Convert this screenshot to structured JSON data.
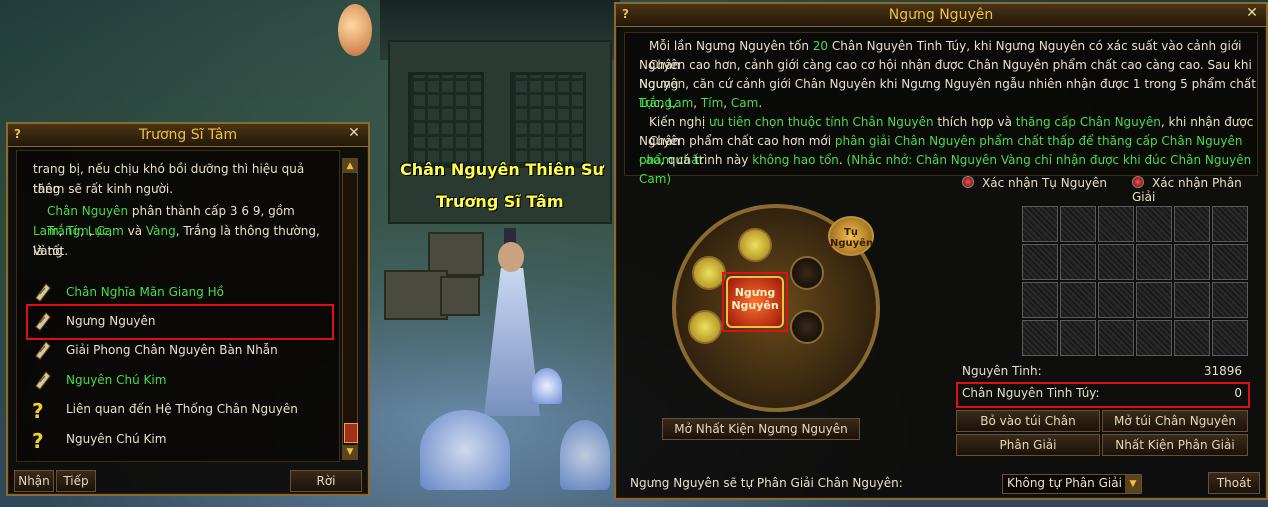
{
  "scene": {
    "npc_name_line1": "Chân Nguyên Thiên Sư",
    "npc_name_line2": "Trương Sĩ Tâm"
  },
  "left_panel": {
    "title": "Trương Sĩ Tâm",
    "help_icon": "?",
    "close_icon": "✕",
    "text_line1": "trang bị, nếu chịu khó bồi dưỡng thì hiệu quả tăng",
    "text_line2": "thêm sẽ rất kinh người.",
    "text_line3_prefix": "Chân Nguyên",
    "text_line3_mid": " phân thành cấp 3 6 9, gồm ",
    "w_trang": "Trắng",
    "w_luc": "Lục",
    "w_lam": "Lam",
    "w_tim": "Tím",
    "w_cam": "Cam",
    "w_vang": "Vàng",
    "text_line4_tail": ", Trắng là thông thường, Vàng",
    "text_line5": "là tốt.",
    "comma": ", ",
    "va": " và ",
    "items": [
      {
        "label": "Chân Nghĩa Mãn Giang Hồ",
        "icon": "scroll-icon",
        "color": "#4adc4a"
      },
      {
        "label": "Ngưng Nguyên",
        "icon": "scroll-icon",
        "color": "#e8e0c8"
      },
      {
        "label": "Giải Phong Chân Nguyên Bàn Nhẫn",
        "icon": "scroll-icon",
        "color": "#e8e0c8"
      },
      {
        "label": "Nguyên Chú Kim",
        "icon": "scroll-icon",
        "color": "#4adc4a"
      },
      {
        "label": "Liên quan đến Hệ Thống Chân Nguyên",
        "icon": "question-icon",
        "color": "#e8e0c8"
      },
      {
        "label": "Nguyên Chú Kim",
        "icon": "question-icon",
        "color": "#e8e0c8"
      }
    ],
    "buttons": {
      "receive": "Nhận",
      "next": "Tiếp",
      "leave": "Rời"
    }
  },
  "right_panel": {
    "title": "Ngưng Nguyên",
    "help_icon": "?",
    "close_icon": "✕",
    "d1_a": "Mỗi lần Ngưng Nguyên tốn ",
    "d1_num": "20",
    "d1_b": " Chân Nguyên Tinh Túy, khi Ngưng Nguyên có xác suất vào cảnh giới Chân",
    "d2": "Nguyên cao hơn, cảnh giới càng cao cơ hội nhận được Chân Nguyên phẩm chất cao càng cao. Sau khi Ngưng",
    "d3_a": "Nguyên, căn cứ cảnh giới Chân Nguyên khi Ngưng Nguyên ngẫu nhiên nhận được 1 trong 5 phẩm chất ",
    "d3_trang": "Trắng",
    "d4_luc": "Lục",
    "d4_lam": "Lam",
    "d4_tim": "Tím",
    "d4_cam": "Cam",
    "d5_a": "Kiến nghị ",
    "d5_g1": "ưu tiên chọn thuộc tính Chân Nguyên",
    "d5_b": " thích hợp và ",
    "d5_g2": "thăng cấp Chân Nguyên",
    "d5_c": ", khi nhận được Chân",
    "d6_a": "Nguyên phẩm chất cao hơn mới ",
    "d6_g": "phân giải Chân Nguyên phẩm chất thấp để thăng cấp Chân Nguyên phẩm chất",
    "d7_g1": "cao",
    "d7_a": ", quá trình này ",
    "d7_g2": "không hao tổn",
    "d7_b": ". ",
    "d7_g3": "(Nhắc nhở: Chân Nguyên Vàng chỉ nhận được khi đúc Chân Nguyên Cam)",
    "radio_auto": "Xác nhận Tụ Nguyên",
    "radio_decompose": "Xác nhận Phân Giải",
    "core_label_1": "Ngưng",
    "core_label_2": "Nguyên",
    "badge_1": "Tụ",
    "badge_2": "Nguyên",
    "open_button": "Mở Nhất Kiện Ngưng Nguyên",
    "stat_tinh_label": "Nguyên Tinh:",
    "stat_tinh_value": "31896",
    "stat_tuy_label": "Chân Nguyên Tinh Túy:",
    "stat_tuy_value": "0",
    "btn_put_bag": "Bỏ vào túi Chân Nguyên",
    "btn_open_bag": "Mở túi Chân Nguyên",
    "btn_decompose": "Phân Giải",
    "btn_batch_decompose": "Nhất Kiện Phân Giải",
    "footer_label": "Ngưng Nguyên sẽ tự Phân Giải Chân Nguyên:",
    "select_value": "Không tự Phân Giải",
    "exit_button": "Thoát"
  },
  "colors": {
    "accent_gold": "#f0c040",
    "green_text": "#4adc4a",
    "highlight_red": "#e01010"
  }
}
